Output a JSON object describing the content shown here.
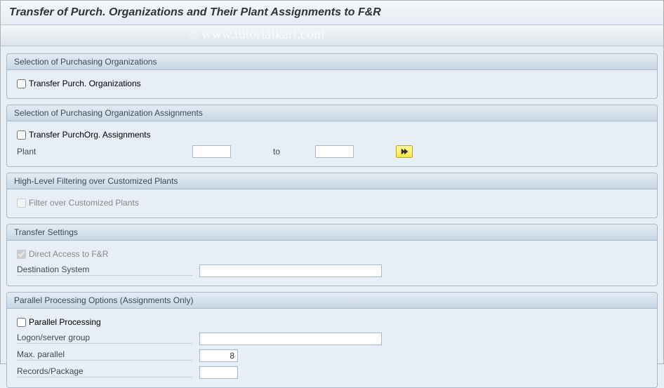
{
  "window": {
    "title": "Transfer of Purch. Organizations and Their Plant Assignments to F&R"
  },
  "watermark": {
    "copy_symbol": "©",
    "text": "www.tutorialkart.com"
  },
  "groups": {
    "sel_purch_orgs": {
      "title": "Selection of Purchasing Organizations",
      "cb_transfer_label": "Transfer Purch. Organizations"
    },
    "sel_assignments": {
      "title": "Selection of Purchasing Organization Assignments",
      "cb_transfer_label": "Transfer PurchOrg. Assignments",
      "plant_label": "Plant",
      "plant_from": "",
      "to_label": "to",
      "plant_to": ""
    },
    "filtering": {
      "title": "High-Level Filtering over Customized Plants",
      "cb_filter_label": "Filter over Customized Plants"
    },
    "transfer_settings": {
      "title": "Transfer Settings",
      "cb_direct_label": "Direct Access to F&R",
      "dest_label": "Destination System",
      "dest_value": ""
    },
    "parallel": {
      "title": "Parallel Processing Options (Assignments Only)",
      "cb_parallel_label": "Parallel Processing",
      "logon_label": "Logon/server group",
      "logon_value": "",
      "max_label": "Max. parallel",
      "max_value": "8",
      "records_label": "Records/Package",
      "records_value": ""
    }
  },
  "icons": {
    "multiple_selection": "arrow-right"
  }
}
